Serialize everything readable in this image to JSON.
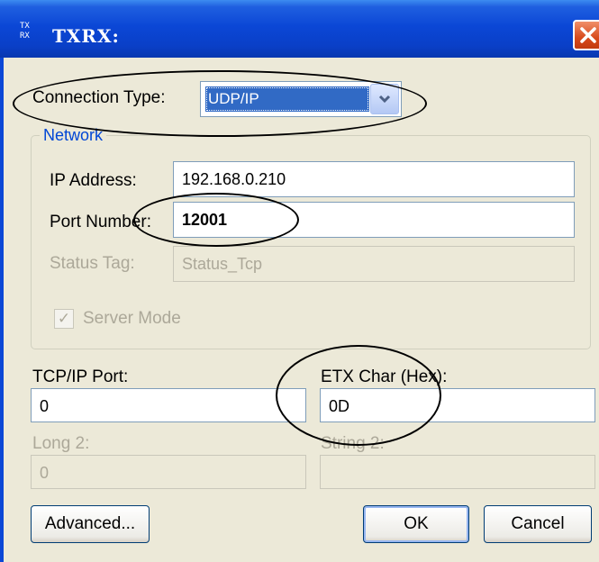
{
  "window": {
    "icon_text": "TX RX",
    "title": "TXRX:"
  },
  "connection": {
    "label": "Connection Type:",
    "value": "UDP/IP",
    "arrow": "▾"
  },
  "network": {
    "group_label": "Network",
    "ip_label": "IP Address:",
    "ip_value": "192.168.0.210",
    "port_label": "Port Number:",
    "port_value": "12001",
    "status_label": "Status Tag:",
    "status_value": "Status_Tcp",
    "server_mode_label": "Server Mode",
    "server_mode_checked": true,
    "check_glyph": "✓"
  },
  "fields": {
    "tcp_port_label": "TCP/IP Port:",
    "tcp_port_value": "0",
    "etx_label": "ETX Char (Hex):",
    "etx_value": "0D",
    "long2_label": "Long 2:",
    "long2_value": "0",
    "string2_label": "String 2:",
    "string2_value": ""
  },
  "buttons": {
    "advanced": "Advanced...",
    "ok": "OK",
    "cancel": "Cancel"
  },
  "icons": {
    "close": "close-icon",
    "app": "txrx-app-icon",
    "dropdown": "chevron-down-icon"
  },
  "colors": {
    "titlebar": "#0b47d6",
    "selection": "#316ac5",
    "group_title": "#0046d5",
    "close": "#d84a1c",
    "disabled_text": "#aca899"
  }
}
